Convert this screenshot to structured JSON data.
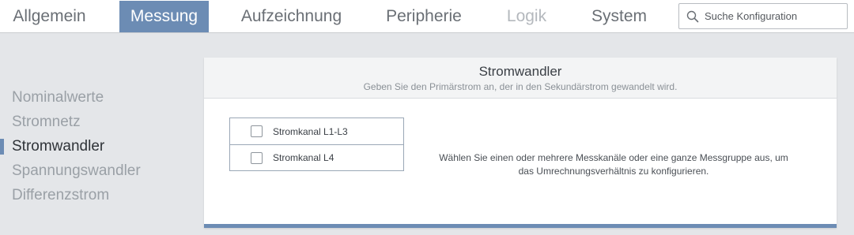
{
  "nav": {
    "tabs": [
      {
        "label": "Allgemein"
      },
      {
        "label": "Messung"
      },
      {
        "label": "Aufzeichnung"
      },
      {
        "label": "Peripherie"
      },
      {
        "label": "Logik"
      },
      {
        "label": "System"
      }
    ],
    "active_tab": "Messung",
    "disabled_tab": "Logik",
    "search": {
      "placeholder": "Suche Konfiguration",
      "icon": "search-icon"
    }
  },
  "sidebar": {
    "items": [
      {
        "label": "Nominalwerte"
      },
      {
        "label": "Stromnetz"
      },
      {
        "label": "Stromwandler"
      },
      {
        "label": "Spannungswandler"
      },
      {
        "label": "Differenzstrom"
      }
    ],
    "active_item": "Stromwandler"
  },
  "panel": {
    "title": "Stromwandler",
    "subtitle": "Geben Sie den Primärstrom an, der in den Sekundärstrom gewandelt wird.",
    "channels": [
      {
        "label": "Stromkanal L1-L3",
        "checked": false
      },
      {
        "label": "Stromkanal L4",
        "checked": false
      }
    ],
    "hint_line1": "Wählen Sie einen oder mehrere Messkanäle oder eine ganze Messgruppe aus, um",
    "hint_line2": "das Umrechnungsverhältnis zu konfigurieren."
  },
  "colors": {
    "accent": "#6c8cb4",
    "background": "#e4e6e9",
    "panel": "#ffffff"
  }
}
